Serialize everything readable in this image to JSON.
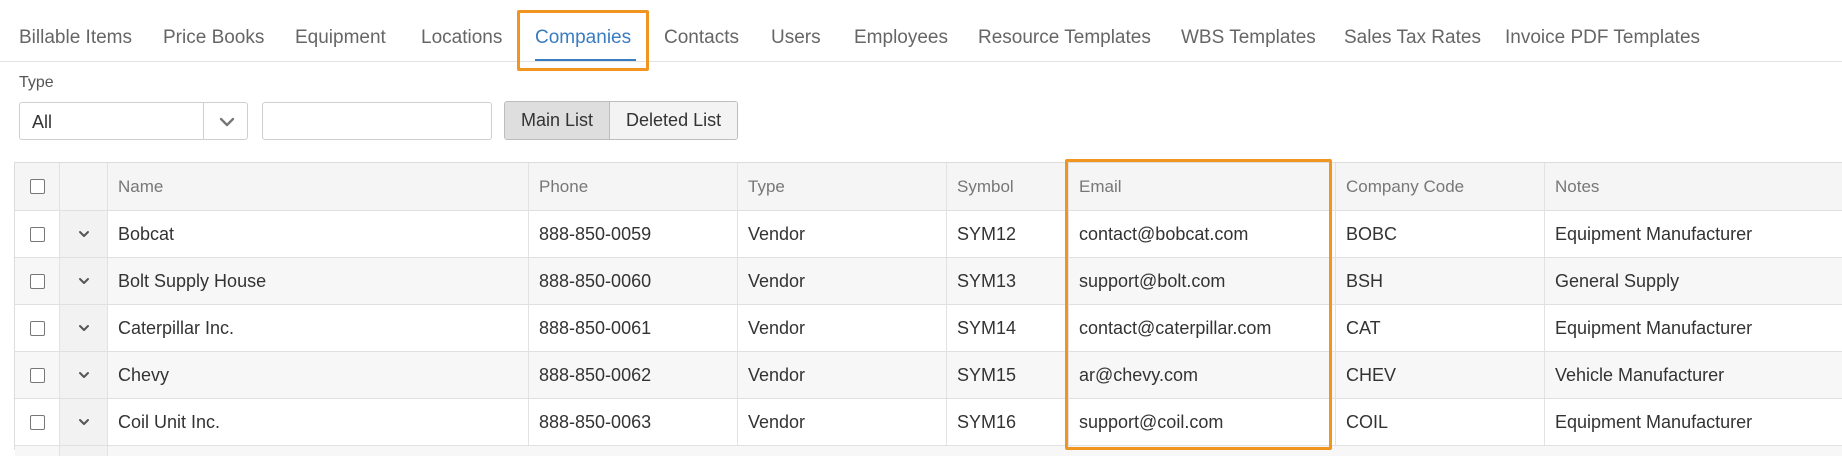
{
  "tabs": [
    {
      "label": "Billable Items",
      "active": false
    },
    {
      "label": "Price Books",
      "active": false
    },
    {
      "label": "Equipment",
      "active": false
    },
    {
      "label": "Locations",
      "active": false
    },
    {
      "label": "Companies",
      "active": true
    },
    {
      "label": "Contacts",
      "active": false
    },
    {
      "label": "Users",
      "active": false
    },
    {
      "label": "Employees",
      "active": false
    },
    {
      "label": "Resource Templates",
      "active": false
    },
    {
      "label": "WBS Templates",
      "active": false
    },
    {
      "label": "Sales Tax Rates",
      "active": false
    },
    {
      "label": "Invoice PDF Templates",
      "active": false
    }
  ],
  "filters": {
    "type_label": "Type",
    "type_value": "All",
    "search_value": "",
    "main_list_label": "Main List",
    "deleted_list_label": "Deleted List"
  },
  "columns": {
    "name": "Name",
    "phone": "Phone",
    "type": "Type",
    "symbol": "Symbol",
    "email": "Email",
    "company_code": "Company Code",
    "notes": "Notes"
  },
  "rows": [
    {
      "name": "Bobcat",
      "phone": "888-850-0059",
      "type": "Vendor",
      "symbol": "SYM12",
      "email": "contact@bobcat.com",
      "company_code": "BOBC",
      "notes": "Equipment Manufacturer"
    },
    {
      "name": "Bolt Supply House",
      "phone": "888-850-0060",
      "type": "Vendor",
      "symbol": "SYM13",
      "email": "support@bolt.com",
      "company_code": "BSH",
      "notes": "General Supply"
    },
    {
      "name": "Caterpillar Inc.",
      "phone": "888-850-0061",
      "type": "Vendor",
      "symbol": "SYM14",
      "email": "contact@caterpillar.com",
      "company_code": "CAT",
      "notes": "Equipment Manufacturer"
    },
    {
      "name": "Chevy",
      "phone": "888-850-0062",
      "type": "Vendor",
      "symbol": "SYM15",
      "email": "ar@chevy.com",
      "company_code": "CHEV",
      "notes": "Vehicle Manufacturer"
    },
    {
      "name": "Coil Unit Inc.",
      "phone": "888-850-0063",
      "type": "Vendor",
      "symbol": "SYM16",
      "email": "support@coil.com",
      "company_code": "COIL",
      "notes": "Equipment Manufacturer"
    }
  ],
  "colors": {
    "accent": "#3a7cc0",
    "highlight": "#f0951f"
  },
  "icons": {
    "dropdown": "chevron-down-icon",
    "row_expand": "chevron-down-icon"
  }
}
